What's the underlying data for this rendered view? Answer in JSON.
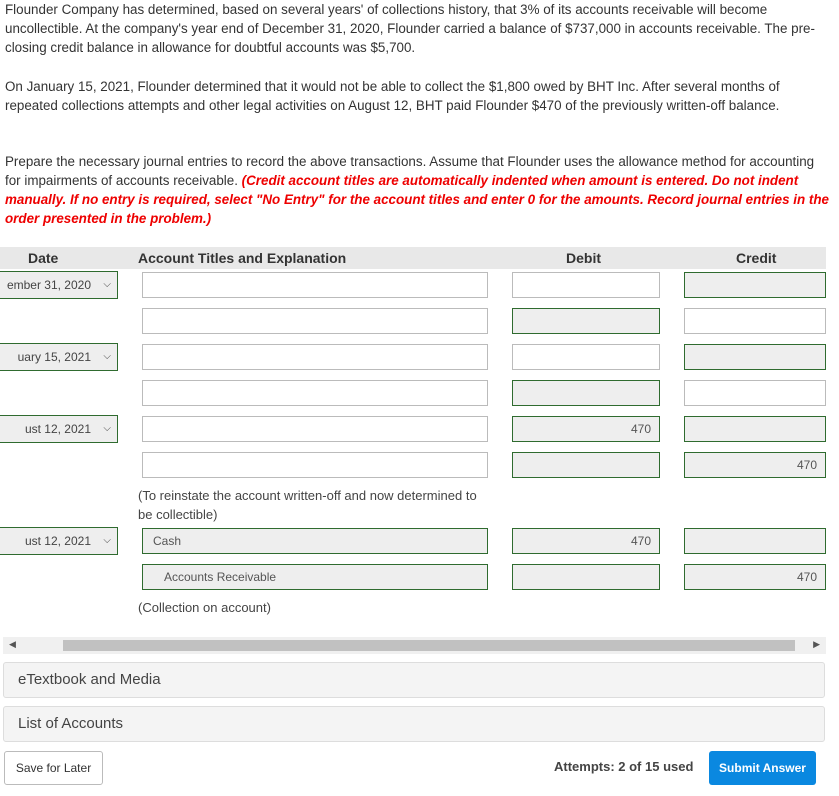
{
  "problem": {
    "p1": "Flounder Company has determined, based on several years' of collections history, that 3% of its accounts receivable will become uncollectible. At the company's year end of December 31, 2020, Flounder carried a balance of $737,000 in accounts receivable. The pre-closing credit balance in allowance for doubtful accounts was $5,700.",
    "p2": "On January 15, 2021, Flounder determined that it would not be able to collect the $1,800 owed by BHT Inc. After several months of repeated collections attempts and other legal activities on August 12, BHT paid Flounder $470 of the previously written-off balance.",
    "p3": "Prepare the necessary journal entries to record the above transactions. Assume that Flounder uses the allowance method for accounting for impairments of accounts receivable. ",
    "p3_red": "(Credit account titles are automatically indented when amount is entered. Do not indent manually. If no entry is required, select \"No Entry\" for the account titles and enter 0 for the amounts. Record journal entries in the order presented in the problem.)"
  },
  "table": {
    "headers": {
      "date": "Date",
      "account": "Account Titles and Explanation",
      "debit": "Debit",
      "credit": "Credit"
    },
    "dates": [
      "ember 31, 2020",
      "uary 15, 2021",
      "ust 12, 2021",
      "ust 12, 2021"
    ],
    "rows": [
      {
        "account": "",
        "debit": "",
        "credit": ""
      },
      {
        "account": "",
        "debit": "",
        "credit": ""
      },
      {
        "account": "",
        "debit": "",
        "credit": ""
      },
      {
        "account": "",
        "debit": "",
        "credit": ""
      },
      {
        "account": "",
        "debit": "470",
        "credit": ""
      },
      {
        "account": "",
        "debit": "",
        "credit": "470"
      },
      {
        "account": "Cash",
        "debit": "470",
        "credit": ""
      },
      {
        "account": "Accounts Receivable",
        "debit": "",
        "credit": "470"
      }
    ],
    "explanations": [
      "(To reinstate the account written-off and now determined to be collectible)",
      "(Collection on account)"
    ]
  },
  "sections": [
    "eTextbook and Media",
    "List of Accounts"
  ],
  "footer": {
    "save": "Save for Later",
    "attempts": "Attempts: 2 of 15 used",
    "submit": "Submit Answer"
  },
  "colors": {
    "accent": "#0a88e0",
    "valid_border": "#2f6b2f",
    "instruction_red": "#e00000"
  }
}
